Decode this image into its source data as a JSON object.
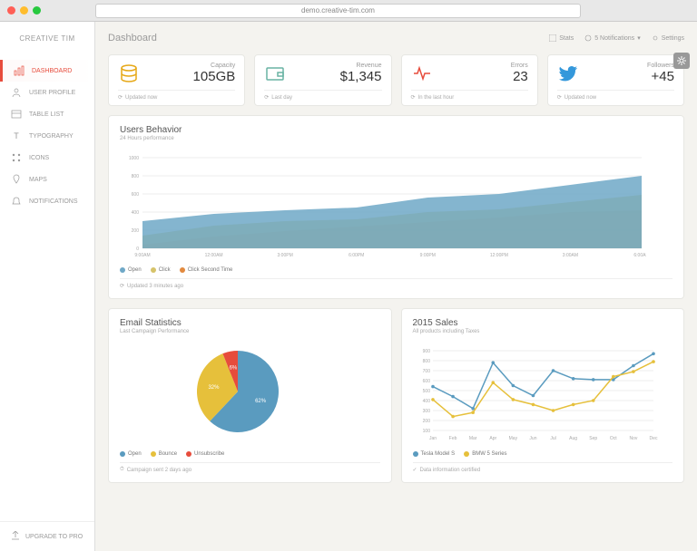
{
  "browser": {
    "url": "demo.creative-tim.com"
  },
  "brand": "CREATIVE TIM",
  "page_title": "Dashboard",
  "top_actions": {
    "stats": "Stats",
    "notifications": "5 Notifications",
    "settings": "Settings"
  },
  "sidebar": {
    "items": [
      {
        "label": "DASHBOARD"
      },
      {
        "label": "USER PROFILE"
      },
      {
        "label": "TABLE LIST"
      },
      {
        "label": "TYPOGRAPHY"
      },
      {
        "label": "ICONS"
      },
      {
        "label": "MAPS"
      },
      {
        "label": "NOTIFICATIONS"
      }
    ],
    "upgrade": "UPGRADE TO PRO"
  },
  "stats": [
    {
      "label": "Capacity",
      "value": "105GB",
      "footer": "Updated now",
      "color": "#e6a817"
    },
    {
      "label": "Revenue",
      "value": "$1,345",
      "footer": "Last day",
      "color": "#68b3a3"
    },
    {
      "label": "Errors",
      "value": "23",
      "footer": "In the last hour",
      "color": "#e74c3c"
    },
    {
      "label": "Followers",
      "value": "+45",
      "footer": "Updated now",
      "color": "#3498db"
    }
  ],
  "behavior": {
    "title": "Users Behavior",
    "sub": "24 Hours performance",
    "legend": [
      "Open",
      "Click",
      "Click Second Time"
    ],
    "footer": "Updated 3 minutes ago"
  },
  "email": {
    "title": "Email Statistics",
    "sub": "Last Campaign Performance",
    "legend": [
      "Open",
      "Bounce",
      "Unsubscribe"
    ],
    "footer": "Campaign sent 2 days ago"
  },
  "sales": {
    "title": "2015 Sales",
    "sub": "All products including Taxes",
    "legend": [
      "Tesla Model S",
      "BMW 5 Series"
    ],
    "footer": "Data information certified"
  },
  "chart_data": [
    {
      "type": "area",
      "title": "Users Behavior",
      "x": [
        "9:00AM",
        "12:00AM",
        "3:00PM",
        "6:00PM",
        "9:00PM",
        "12:00PM",
        "3:00AM",
        "6:00AM"
      ],
      "ylim": [
        0,
        1000
      ],
      "yticks": [
        0,
        200,
        400,
        600,
        800,
        1000
      ],
      "series": [
        {
          "name": "Open",
          "color": "#6fa8c7",
          "values": [
            300,
            380,
            420,
            450,
            560,
            600,
            700,
            800
          ]
        },
        {
          "name": "Click",
          "color": "#d6c36a",
          "values": [
            140,
            250,
            300,
            320,
            400,
            430,
            510,
            590
          ]
        },
        {
          "name": "Click Second Time",
          "color": "#e28a3f",
          "values": [
            40,
            130,
            190,
            240,
            290,
            340,
            400,
            420
          ]
        }
      ]
    },
    {
      "type": "pie",
      "title": "Email Statistics",
      "slices": [
        {
          "name": "Open",
          "value": 62,
          "color": "#5a9bbf",
          "label": "62%"
        },
        {
          "name": "Bounce",
          "value": 32,
          "color": "#e6c03b",
          "label": "32%"
        },
        {
          "name": "Unsubscribe",
          "value": 6,
          "color": "#e74c3c",
          "label": "6%"
        }
      ]
    },
    {
      "type": "line",
      "title": "2015 Sales",
      "x": [
        "Jan",
        "Feb",
        "Mar",
        "Apr",
        "May",
        "Jun",
        "Jul",
        "Aug",
        "Sep",
        "Oct",
        "Nov",
        "Dec"
      ],
      "ylim": [
        100,
        900
      ],
      "yticks": [
        100,
        200,
        300,
        400,
        500,
        600,
        700,
        800,
        900
      ],
      "series": [
        {
          "name": "Tesla Model S",
          "color": "#5a9bbf",
          "values": [
            540,
            440,
            320,
            780,
            550,
            450,
            700,
            620,
            610,
            610,
            750,
            870
          ]
        },
        {
          "name": "BMW 5 Series",
          "color": "#e6c03b",
          "values": [
            410,
            240,
            280,
            580,
            410,
            360,
            300,
            360,
            400,
            640,
            690,
            790
          ]
        }
      ]
    }
  ]
}
